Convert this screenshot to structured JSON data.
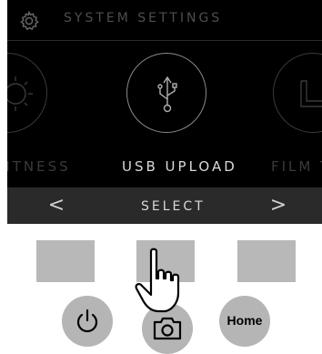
{
  "header": {
    "title": "SYSTEM SETTINGS",
    "icon": "gear-icon"
  },
  "carousel": {
    "items": [
      {
        "label": "BRIGHTNESS",
        "visible_label": "RIGHTNESS",
        "icon": "sun-icon",
        "selected": false
      },
      {
        "label": "USB UPLOAD",
        "icon": "usb-icon",
        "selected": true
      },
      {
        "label": "FILM T",
        "icon": "film-icon",
        "selected": false
      }
    ]
  },
  "bottom_bar": {
    "prev": "<",
    "select": "SELECT",
    "next": ">"
  },
  "hardware": {
    "home_label": "Home",
    "buttons": [
      "power-icon",
      "camera-icon",
      "home"
    ]
  },
  "colors": {
    "screen_bg": "#000000",
    "bar_bg": "#2a2a2a",
    "button_gray": "#b8b8b8",
    "active_text": "#d8d8d8",
    "inactive_text": "#3a3a3a"
  }
}
